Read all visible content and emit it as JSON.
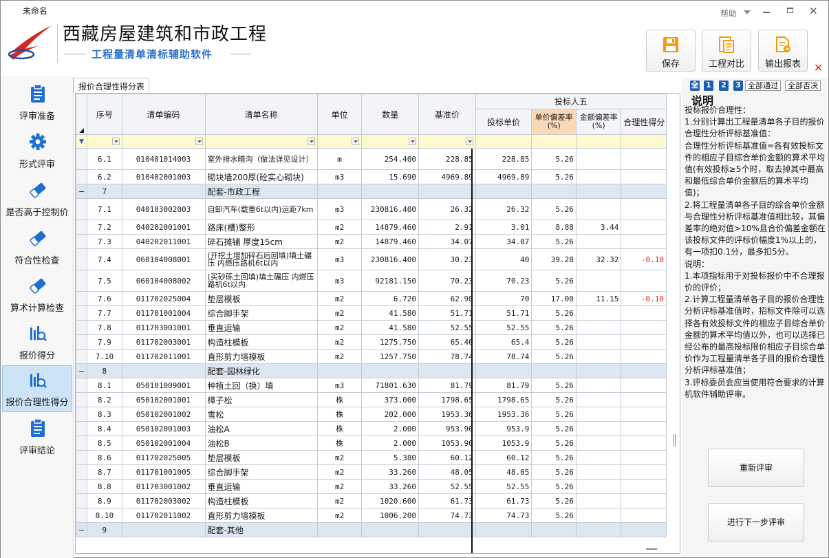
{
  "window": {
    "title": "未命名",
    "help": "帮助"
  },
  "app": {
    "title": "西藏房屋建筑和市政工程",
    "subtitle": "工程量清单清标辅助软件"
  },
  "toolbar": {
    "save": "保存",
    "compare": "工程对比",
    "export": "输出报表"
  },
  "sidebar": {
    "items": [
      {
        "label": "评审准备",
        "icon": "clipboard-icon"
      },
      {
        "label": "形式评审",
        "icon": "gear-icon"
      },
      {
        "label": "是否高于控制价",
        "icon": "eraser-icon"
      },
      {
        "label": "符合性检查",
        "icon": "eraser-icon"
      },
      {
        "label": "算术计算检查",
        "icon": "eraser-icon"
      },
      {
        "label": "报价得分",
        "icon": "chart-search-icon"
      },
      {
        "label": "报价合理性得分",
        "icon": "chart-search-icon"
      },
      {
        "label": "评审结论",
        "icon": "clipboard-icon"
      }
    ]
  },
  "tab": "报价合理性得分表",
  "table": {
    "group_header": "投标人五",
    "headers": {
      "seq": "序号",
      "code": "清单编码",
      "name": "清单名称",
      "unit": "单位",
      "qty": "数量",
      "base": "基准价",
      "bid": "投标单价",
      "dev_rate": "单价偏差率\n(%)",
      "dev_amt": "金额偏差率\n(%)",
      "score": "合理性得分"
    },
    "rows": [
      {
        "type": "item",
        "tall": true,
        "seq": "6.1",
        "code": "010401014003",
        "name": "室外排水暗沟（做法详见设计）",
        "unit": "m",
        "qty": "254.400",
        "base": "228.85",
        "bid": "228.85",
        "dr": "5.26",
        "da": "",
        "sc": ""
      },
      {
        "type": "item",
        "seq": "6.2",
        "code": "010402001003",
        "name": "砌块墙200厚(砼实心砌块)",
        "unit": "m3",
        "qty": "15.690",
        "base": "4969.89",
        "bid": "4969.89",
        "dr": "5.26",
        "da": "",
        "sc": ""
      },
      {
        "type": "group",
        "seq": "7",
        "name": "配套-市政工程"
      },
      {
        "type": "item",
        "tall": true,
        "seq": "7.1",
        "code": "040103002003",
        "name": "自卸汽车(载重6t以内)运距7km",
        "unit": "m3",
        "qty": "230816.400",
        "base": "26.32",
        "bid": "26.32",
        "dr": "5.26",
        "da": "",
        "sc": ""
      },
      {
        "type": "item",
        "seq": "7.2",
        "code": "040202001001",
        "name": "路床(槽)整形",
        "unit": "m2",
        "qty": "14879.460",
        "base": "2.91",
        "bid": "3.01",
        "dr": "8.88",
        "da": "3.44",
        "sc": ""
      },
      {
        "type": "item",
        "seq": "7.3",
        "code": "040202011001",
        "name": "碎石摊铺 厚度15cm",
        "unit": "m2",
        "qty": "14879.460",
        "base": "34.07",
        "bid": "34.07",
        "dr": "5.26",
        "da": "",
        "sc": ""
      },
      {
        "type": "item",
        "tall": true,
        "seq": "7.4",
        "code": "060104008001",
        "name": "(开挖土增加碎石后回填)填土碾压 内燃压路机6t以内",
        "unit": "m3",
        "qty": "230816.400",
        "base": "30.23",
        "bid": "40",
        "dr": "39.28",
        "da": "32.32",
        "sc": "-0.10"
      },
      {
        "type": "item",
        "tall": true,
        "seq": "7.5",
        "code": "060104008002",
        "name": "(买砂砾土回填)填土碾压 内燃压路机6t以内",
        "unit": "m3",
        "qty": "92181.150",
        "base": "70.23",
        "bid": "70.23",
        "dr": "5.26",
        "da": "",
        "sc": ""
      },
      {
        "type": "item",
        "seq": "7.6",
        "code": "011702025004",
        "name": "垫层模板",
        "unit": "m2",
        "qty": "6.720",
        "base": "62.98",
        "bid": "70",
        "dr": "17.00",
        "da": "11.15",
        "sc": "-0.10"
      },
      {
        "type": "item",
        "seq": "7.7",
        "code": "011701001004",
        "name": "综合脚手架",
        "unit": "m2",
        "qty": "41.580",
        "base": "51.71",
        "bid": "51.71",
        "dr": "5.26",
        "da": "",
        "sc": ""
      },
      {
        "type": "item",
        "seq": "7.8",
        "code": "011703001001",
        "name": "垂直运输",
        "unit": "m2",
        "qty": "41.580",
        "base": "52.55",
        "bid": "52.55",
        "dr": "5.26",
        "da": "",
        "sc": ""
      },
      {
        "type": "item",
        "seq": "7.9",
        "code": "011702003001",
        "name": "构造柱模板",
        "unit": "m2",
        "qty": "1275.750",
        "base": "65.40",
        "bid": "65.4",
        "dr": "5.26",
        "da": "",
        "sc": ""
      },
      {
        "type": "item",
        "seq": "7.10",
        "code": "011702011001",
        "name": "直形剪力墙模板",
        "unit": "m2",
        "qty": "1257.750",
        "base": "78.74",
        "bid": "78.74",
        "dr": "5.26",
        "da": "",
        "sc": ""
      },
      {
        "type": "group",
        "seq": "8",
        "name": "配套-园林绿化"
      },
      {
        "type": "item",
        "seq": "8.1",
        "code": "050101009001",
        "name": "种植土回（换）填",
        "unit": "m3",
        "qty": "71801.630",
        "base": "81.79",
        "bid": "81.79",
        "dr": "5.26",
        "da": "",
        "sc": ""
      },
      {
        "type": "item",
        "seq": "8.2",
        "code": "050102001001",
        "name": "樟子松",
        "unit": "株",
        "qty": "373.000",
        "base": "1798.65",
        "bid": "1798.65",
        "dr": "5.26",
        "da": "",
        "sc": ""
      },
      {
        "type": "item",
        "seq": "8.3",
        "code": "050102001002",
        "name": "雪松",
        "unit": "株",
        "qty": "202.000",
        "base": "1953.36",
        "bid": "1953.36",
        "dr": "5.26",
        "da": "",
        "sc": ""
      },
      {
        "type": "item",
        "seq": "8.4",
        "code": "050102001003",
        "name": "油松A",
        "unit": "株",
        "qty": "2.000",
        "base": "953.90",
        "bid": "953.9",
        "dr": "5.26",
        "da": "",
        "sc": ""
      },
      {
        "type": "item",
        "seq": "8.5",
        "code": "050102001004",
        "name": "油松B",
        "unit": "株",
        "qty": "2.000",
        "base": "1053.90",
        "bid": "1053.9",
        "dr": "5.26",
        "da": "",
        "sc": ""
      },
      {
        "type": "item",
        "seq": "8.6",
        "code": "011702025005",
        "name": "垫层模板",
        "unit": "m2",
        "qty": "5.380",
        "base": "60.12",
        "bid": "60.12",
        "dr": "5.26",
        "da": "",
        "sc": ""
      },
      {
        "type": "item",
        "seq": "8.7",
        "code": "011701001005",
        "name": "综合脚手架",
        "unit": "m2",
        "qty": "33.260",
        "base": "48.05",
        "bid": "48.05",
        "dr": "5.26",
        "da": "",
        "sc": ""
      },
      {
        "type": "item",
        "seq": "8.8",
        "code": "011703001002",
        "name": "垂直运输",
        "unit": "m2",
        "qty": "33.260",
        "base": "52.55",
        "bid": "52.55",
        "dr": "5.26",
        "da": "",
        "sc": ""
      },
      {
        "type": "item",
        "seq": "8.9",
        "code": "011702003002",
        "name": "构造柱模板",
        "unit": "m2",
        "qty": "1020.600",
        "base": "61.73",
        "bid": "61.73",
        "dr": "5.26",
        "da": "",
        "sc": ""
      },
      {
        "type": "item",
        "seq": "8.10",
        "code": "011702011002",
        "name": "直形剪力墙模板",
        "unit": "m2",
        "qty": "1006.200",
        "base": "74.73",
        "bid": "74.73",
        "dr": "5.26",
        "da": "",
        "sc": ""
      },
      {
        "type": "group",
        "seq": "9",
        "name": "配套-其他"
      }
    ]
  },
  "right_panel": {
    "filters": {
      "all": "全",
      "b1": "1",
      "b2": "2",
      "b3": "3",
      "pass_all": "全部通过",
      "reject_all": "全部否决"
    },
    "title": "说明",
    "description": "投标报价合理性：\n1.分别计算出工程量清单各子目的报价合理性分析评标基准值：\n合理性分析评标基准值=各有效投标文件的相应子目综合单价金额的算术平均值(有效投标≥5个时，取去掉其中最高和最低综合单价金额后的算术平均值)；\n2.将工程量清单各子目的综合单价金额与合理性分析评标基准值相比较，其偏差率的绝对值>10%且合价偏差金额在该投标文件的评标价幅度1%以上的，有一项扣0.1分，最多扣5分。\n说明：\n1.本项指标用于对投标报价中不合理报价的评价；\n2.计算工程量清单各子目的报价合理性分析评标基准值时，招标文件除可以选择各有效投标文件的相应子目综合单价金额的算术平均值以外，也可以选择已经公布的最高投标限价相应子目综合单价作为工程量清单各子目的报价合理性分析评标基准值；\n3.评标委员会应当使用符合要求的计算机软件辅助评审。",
    "re_review": "重新评审",
    "next_step": "进行下一步评审"
  }
}
